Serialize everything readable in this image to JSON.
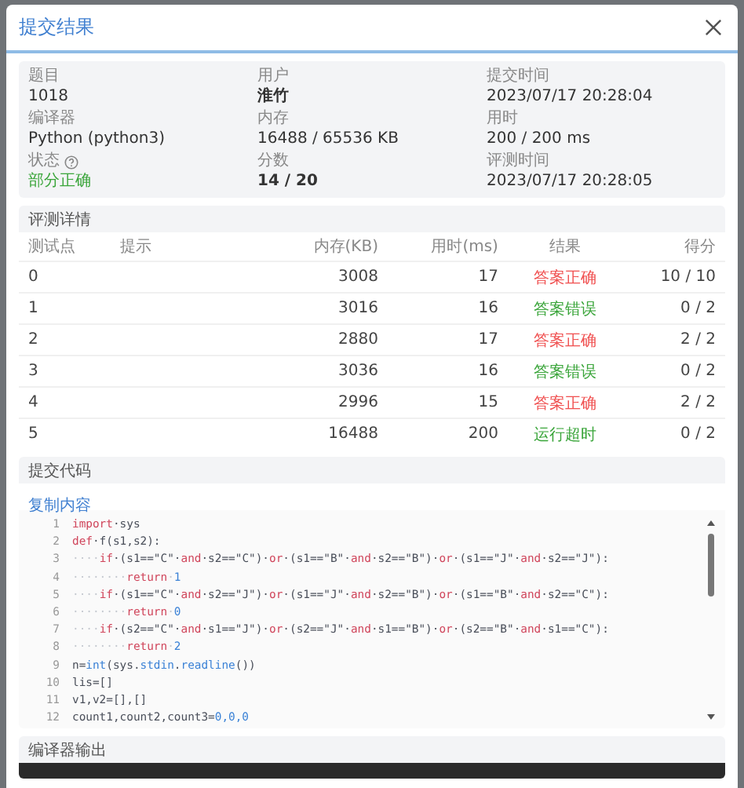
{
  "dialog": {
    "title": "提交结果"
  },
  "info": [
    {
      "label": "题目",
      "value": "1018",
      "kind": "plain"
    },
    {
      "label": "用户",
      "value": "淮竹",
      "kind": "bold"
    },
    {
      "label": "提交时间",
      "value": "2023/07/17 20:28:04",
      "kind": "plain"
    },
    {
      "label": "编译器",
      "value": "Python (python3)",
      "kind": "plain"
    },
    {
      "label": "内存",
      "value": "16488 / 65536 KB",
      "kind": "plain"
    },
    {
      "label": "用时",
      "value": "200 / 200 ms",
      "kind": "plain"
    },
    {
      "label": "状态",
      "value": "部分正确",
      "kind": "status",
      "color": "#3aa53a"
    },
    {
      "label": "分数",
      "value": "14 / 20",
      "kind": "bold"
    },
    {
      "label": "评测时间",
      "value": "2023/07/17 20:28:05",
      "kind": "plain"
    }
  ],
  "judge": {
    "title": "评测详情",
    "columns": [
      "测试点",
      "提示",
      "内存(KB)",
      "用时(ms)",
      "结果",
      "得分"
    ],
    "rows": [
      {
        "case": "0",
        "memory": "3008",
        "time": "17",
        "result": "答案正确",
        "color": "#f05050",
        "score": "10 / 10"
      },
      {
        "case": "1",
        "memory": "3016",
        "time": "16",
        "result": "答案错误",
        "color": "#3aa53a",
        "score": "0 / 2"
      },
      {
        "case": "2",
        "memory": "2880",
        "time": "17",
        "result": "答案正确",
        "color": "#f05050",
        "score": "2 / 2"
      },
      {
        "case": "3",
        "memory": "3036",
        "time": "16",
        "result": "答案错误",
        "color": "#3aa53a",
        "score": "0 / 2"
      },
      {
        "case": "4",
        "memory": "2996",
        "time": "15",
        "result": "答案正确",
        "color": "#f05050",
        "score": "2 / 2"
      },
      {
        "case": "5",
        "memory": "16488",
        "time": "200",
        "result": "运行超时",
        "color": "#3aa53a",
        "score": "0 / 2"
      }
    ]
  },
  "code": {
    "title": "提交代码",
    "copy_link": "复制内容",
    "lines": [
      {
        "number": "1",
        "tokens": [
          {
            "text": "import",
            "kind": "keyword"
          },
          {
            "text": "·sys",
            "kind": "plain"
          }
        ]
      },
      {
        "number": "2",
        "tokens": [
          {
            "text": "def",
            "kind": "keyword"
          },
          {
            "text": "·f(s1,s2):",
            "kind": "plain"
          }
        ]
      },
      {
        "number": "3",
        "tokens": [
          {
            "text": "····",
            "kind": "whitespace"
          },
          {
            "text": "if",
            "kind": "keyword"
          },
          {
            "text": "·(s1==\"C\"·",
            "kind": "plain"
          },
          {
            "text": "and",
            "kind": "keyword"
          },
          {
            "text": "·s2==\"C\")·",
            "kind": "plain"
          },
          {
            "text": "or",
            "kind": "keyword"
          },
          {
            "text": "·(s1==\"B\"·",
            "kind": "plain"
          },
          {
            "text": "and",
            "kind": "keyword"
          },
          {
            "text": "·s2==\"B\")·",
            "kind": "plain"
          },
          {
            "text": "or",
            "kind": "keyword"
          },
          {
            "text": "·(s1==\"J\"·",
            "kind": "plain"
          },
          {
            "text": "and",
            "kind": "keyword"
          },
          {
            "text": "·s2==\"J\"):",
            "kind": "plain"
          }
        ]
      },
      {
        "number": "4",
        "tokens": [
          {
            "text": "········",
            "kind": "whitespace"
          },
          {
            "text": "return",
            "kind": "keyword"
          },
          {
            "text": "·",
            "kind": "whitespace"
          },
          {
            "text": "1",
            "kind": "number"
          }
        ]
      },
      {
        "number": "5",
        "tokens": [
          {
            "text": "····",
            "kind": "whitespace"
          },
          {
            "text": "if",
            "kind": "keyword"
          },
          {
            "text": "·(s1==\"C\"·",
            "kind": "plain"
          },
          {
            "text": "and",
            "kind": "keyword"
          },
          {
            "text": "·s2==\"J\")·",
            "kind": "plain"
          },
          {
            "text": "or",
            "kind": "keyword"
          },
          {
            "text": "·(s1==\"J\"·",
            "kind": "plain"
          },
          {
            "text": "and",
            "kind": "keyword"
          },
          {
            "text": "·s2==\"B\")·",
            "kind": "plain"
          },
          {
            "text": "or",
            "kind": "keyword"
          },
          {
            "text": "·(s1==\"B\"·",
            "kind": "plain"
          },
          {
            "text": "and",
            "kind": "keyword"
          },
          {
            "text": "·s2==\"C\"):",
            "kind": "plain"
          }
        ]
      },
      {
        "number": "6",
        "tokens": [
          {
            "text": "········",
            "kind": "whitespace"
          },
          {
            "text": "return",
            "kind": "keyword"
          },
          {
            "text": "·",
            "kind": "whitespace"
          },
          {
            "text": "0",
            "kind": "number"
          }
        ]
      },
      {
        "number": "7",
        "tokens": [
          {
            "text": "····",
            "kind": "whitespace"
          },
          {
            "text": "if",
            "kind": "keyword"
          },
          {
            "text": "·(s2==\"C\"·",
            "kind": "plain"
          },
          {
            "text": "and",
            "kind": "keyword"
          },
          {
            "text": "·s1==\"J\")·",
            "kind": "plain"
          },
          {
            "text": "or",
            "kind": "keyword"
          },
          {
            "text": "·(s2==\"J\"·",
            "kind": "plain"
          },
          {
            "text": "and",
            "kind": "keyword"
          },
          {
            "text": "·s1==\"B\")·",
            "kind": "plain"
          },
          {
            "text": "or",
            "kind": "keyword"
          },
          {
            "text": "·(s2==\"B\"·",
            "kind": "plain"
          },
          {
            "text": "and",
            "kind": "keyword"
          },
          {
            "text": "·s1==\"C\"):",
            "kind": "plain"
          }
        ]
      },
      {
        "number": "8",
        "tokens": [
          {
            "text": "········",
            "kind": "whitespace"
          },
          {
            "text": "return",
            "kind": "keyword"
          },
          {
            "text": "·",
            "kind": "whitespace"
          },
          {
            "text": "2",
            "kind": "number"
          }
        ]
      },
      {
        "number": "9",
        "tokens": [
          {
            "text": "n=",
            "kind": "plain"
          },
          {
            "text": "int",
            "kind": "number"
          },
          {
            "text": "(sys.",
            "kind": "plain"
          },
          {
            "text": "stdin",
            "kind": "number"
          },
          {
            "text": ".",
            "kind": "plain"
          },
          {
            "text": "readline",
            "kind": "number"
          },
          {
            "text": "())",
            "kind": "plain"
          }
        ]
      },
      {
        "number": "10",
        "tokens": [
          {
            "text": "lis=[]",
            "kind": "plain"
          }
        ]
      },
      {
        "number": "11",
        "tokens": [
          {
            "text": "v1,v2=[],[]",
            "kind": "plain"
          }
        ]
      },
      {
        "number": "12",
        "tokens": [
          {
            "text": "count1,count2,count3=",
            "kind": "plain"
          },
          {
            "text": "0,0,0",
            "kind": "number"
          }
        ]
      }
    ]
  },
  "compiler_output": {
    "title": "编译器输出"
  }
}
